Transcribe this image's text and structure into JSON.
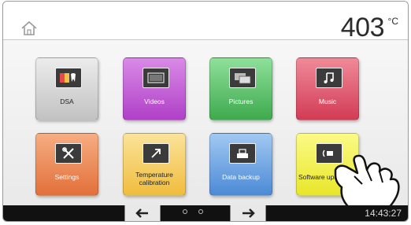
{
  "header": {
    "home_icon": "home-icon",
    "temperature": "403",
    "temperature_unit": "°C"
  },
  "tiles": [
    {
      "label": "DSA",
      "color": "#d6d6d6",
      "icon": "dsa-icon"
    },
    {
      "label": "Videos",
      "color": "#c962d9",
      "icon": "video-icon"
    },
    {
      "label": "Pictures",
      "color": "#5dc46a",
      "icon": "pictures-icon"
    },
    {
      "label": "Music",
      "color": "#e65b72",
      "icon": "music-note-icon"
    },
    {
      "label": "Settings",
      "color": "#f08a55",
      "icon": "tools-icon"
    },
    {
      "label": "Temperature calibration",
      "label_line1": "Temperature",
      "label_line2": "calibration",
      "color": "#f6d46a",
      "icon": "calibration-arrow-icon"
    },
    {
      "label": "Data backup",
      "color": "#6fa6e4",
      "icon": "usb-icon"
    },
    {
      "label": "Software update",
      "label_visible": "Software upda",
      "color": "#f4f34e",
      "icon": "software-update-icon"
    }
  ],
  "footer": {
    "prev_icon": "arrow-left-icon",
    "next_icon": "arrow-right-icon",
    "page_count": 3,
    "active_page": 2,
    "time": "14:43:27"
  }
}
